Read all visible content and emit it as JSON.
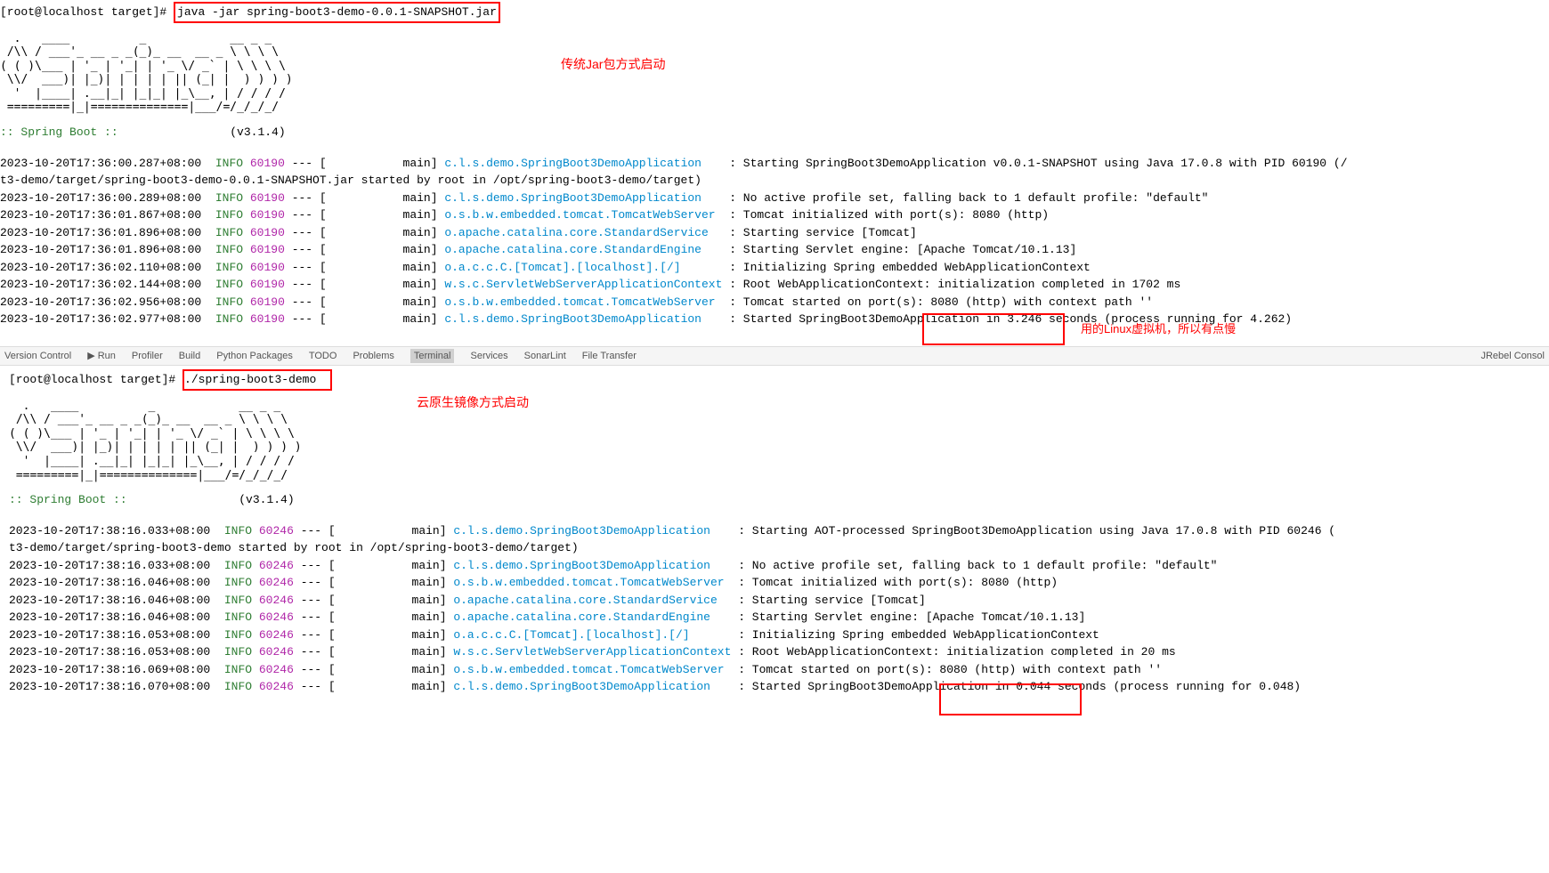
{
  "section1": {
    "prompt": "[root@localhost target]#",
    "command": "java -jar spring-boot3-demo-0.0.1-SNAPSHOT.jar",
    "annotation": "传统Jar包方式启动",
    "ascii_art": "  .   ____          _            __ _ _\n /\\\\ / ___'_ __ _ _(_)_ __  __ _ \\ \\ \\ \\\n( ( )\\___ | '_ | '_| | '_ \\/ _` | \\ \\ \\ \\\n \\\\/  ___)| |_)| | | | | || (_| |  ) ) ) )\n  '  |____| .__|_| |_|_| |_\\__, | / / / /\n =========|_|==============|___/=/_/_/_/",
    "spring_boot_label": ":: Spring Boot ::",
    "version": "(v3.1.4)",
    "logs": [
      {
        "ts": "2023-10-20T17:36:00.287+08:00",
        "level": "INFO",
        "pid": "60190",
        "thread": "main",
        "logger": "c.l.s.demo.SpringBoot3DemoApplication",
        "msg": "Starting SpringBoot3DemoApplication v0.0.1-SNAPSHOT using Java 17.0.8 with PID 60190 (/"
      },
      {
        "continuation": "t3-demo/target/spring-boot3-demo-0.0.1-SNAPSHOT.jar started by root in /opt/spring-boot3-demo/target)"
      },
      {
        "ts": "2023-10-20T17:36:00.289+08:00",
        "level": "INFO",
        "pid": "60190",
        "thread": "main",
        "logger": "c.l.s.demo.SpringBoot3DemoApplication",
        "msg": "No active profile set, falling back to 1 default profile: \"default\""
      },
      {
        "ts": "2023-10-20T17:36:01.867+08:00",
        "level": "INFO",
        "pid": "60190",
        "thread": "main",
        "logger": "o.s.b.w.embedded.tomcat.TomcatWebServer",
        "msg": "Tomcat initialized with port(s): 8080 (http)"
      },
      {
        "ts": "2023-10-20T17:36:01.896+08:00",
        "level": "INFO",
        "pid": "60190",
        "thread": "main",
        "logger": "o.apache.catalina.core.StandardService",
        "msg": "Starting service [Tomcat]"
      },
      {
        "ts": "2023-10-20T17:36:01.896+08:00",
        "level": "INFO",
        "pid": "60190",
        "thread": "main",
        "logger": "o.apache.catalina.core.StandardEngine",
        "msg": "Starting Servlet engine: [Apache Tomcat/10.1.13]"
      },
      {
        "ts": "2023-10-20T17:36:02.110+08:00",
        "level": "INFO",
        "pid": "60190",
        "thread": "main",
        "logger": "o.a.c.c.C.[Tomcat].[localhost].[/]",
        "msg": "Initializing Spring embedded WebApplicationContext"
      },
      {
        "ts": "2023-10-20T17:36:02.144+08:00",
        "level": "INFO",
        "pid": "60190",
        "thread": "main",
        "logger": "w.s.c.ServletWebServerApplicationContext",
        "msg": "Root WebApplicationContext: initialization completed in 1702 ms"
      },
      {
        "ts": "2023-10-20T17:36:02.956+08:00",
        "level": "INFO",
        "pid": "60190",
        "thread": "main",
        "logger": "o.s.b.w.embedded.tomcat.TomcatWebServer",
        "msg": "Tomcat started on port(s): 8080 (http) with context path ''"
      },
      {
        "ts": "2023-10-20T17:36:02.977+08:00",
        "level": "INFO",
        "pid": "60190",
        "thread": "main",
        "logger": "c.l.s.demo.SpringBoot3DemoApplication",
        "msg": "Started SpringBoot3DemoApplication in 3.246 seconds (process running for 4.262)"
      }
    ],
    "note": "用的Linux虚拟机，所以有点慢"
  },
  "toolbar": {
    "items": [
      "Version Control",
      "Run",
      "Profiler",
      "Build",
      "Python Packages",
      "TODO",
      "Problems",
      "Terminal",
      "Services",
      "SonarLint",
      "File Transfer"
    ],
    "right": "JRebel Consol"
  },
  "section2": {
    "prompt": "[root@localhost target]#",
    "command": "./spring-boot3-demo",
    "annotation": "云原生镜像方式启动",
    "ascii_art": "  .   ____          _            __ _ _\n /\\\\ / ___'_ __ _ _(_)_ __  __ _ \\ \\ \\ \\\n( ( )\\___ | '_ | '_| | '_ \\/ _` | \\ \\ \\ \\\n \\\\/  ___)| |_)| | | | | || (_| |  ) ) ) )\n  '  |____| .__|_| |_|_| |_\\__, | / / / /\n =========|_|==============|___/=/_/_/_/",
    "spring_boot_label": ":: Spring Boot ::",
    "version": "(v3.1.4)",
    "logs": [
      {
        "ts": "2023-10-20T17:38:16.033+08:00",
        "level": "INFO",
        "pid": "60246",
        "thread": "main",
        "logger": "c.l.s.demo.SpringBoot3DemoApplication",
        "msg": "Starting AOT-processed SpringBoot3DemoApplication using Java 17.0.8 with PID 60246 ("
      },
      {
        "continuation": "t3-demo/target/spring-boot3-demo started by root in /opt/spring-boot3-demo/target)"
      },
      {
        "ts": "2023-10-20T17:38:16.033+08:00",
        "level": "INFO",
        "pid": "60246",
        "thread": "main",
        "logger": "c.l.s.demo.SpringBoot3DemoApplication",
        "msg": "No active profile set, falling back to 1 default profile: \"default\""
      },
      {
        "ts": "2023-10-20T17:38:16.046+08:00",
        "level": "INFO",
        "pid": "60246",
        "thread": "main",
        "logger": "o.s.b.w.embedded.tomcat.TomcatWebServer",
        "msg": "Tomcat initialized with port(s): 8080 (http)"
      },
      {
        "ts": "2023-10-20T17:38:16.046+08:00",
        "level": "INFO",
        "pid": "60246",
        "thread": "main",
        "logger": "o.apache.catalina.core.StandardService",
        "msg": "Starting service [Tomcat]"
      },
      {
        "ts": "2023-10-20T17:38:16.046+08:00",
        "level": "INFO",
        "pid": "60246",
        "thread": "main",
        "logger": "o.apache.catalina.core.StandardEngine",
        "msg": "Starting Servlet engine: [Apache Tomcat/10.1.13]"
      },
      {
        "ts": "2023-10-20T17:38:16.053+08:00",
        "level": "INFO",
        "pid": "60246",
        "thread": "main",
        "logger": "o.a.c.c.C.[Tomcat].[localhost].[/]",
        "msg": "Initializing Spring embedded WebApplicationContext"
      },
      {
        "ts": "2023-10-20T17:38:16.053+08:00",
        "level": "INFO",
        "pid": "60246",
        "thread": "main",
        "logger": "w.s.c.ServletWebServerApplicationContext",
        "msg": "Root WebApplicationContext: initialization completed in 20 ms"
      },
      {
        "ts": "2023-10-20T17:38:16.069+08:00",
        "level": "INFO",
        "pid": "60246",
        "thread": "main",
        "logger": "o.s.b.w.embedded.tomcat.TomcatWebServer",
        "msg": "Tomcat started on port(s): 8080 (http) with context path ''"
      },
      {
        "ts": "2023-10-20T17:38:16.070+08:00",
        "level": "INFO",
        "pid": "60246",
        "thread": "main",
        "logger": "c.l.s.demo.SpringBoot3DemoApplication",
        "msg": "Started SpringBoot3DemoApplication in 0.044 seconds (process running for 0.048)"
      }
    ]
  }
}
